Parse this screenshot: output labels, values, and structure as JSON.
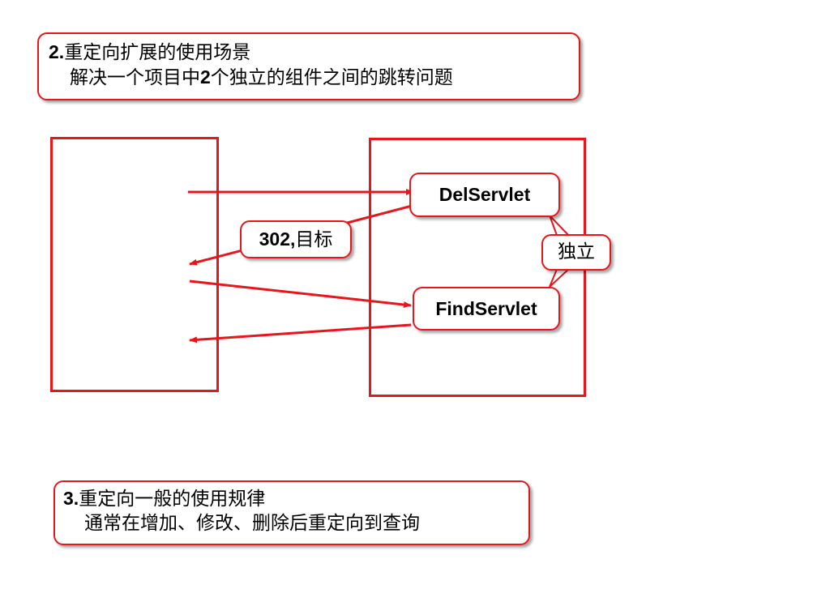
{
  "top_note": {
    "number": "2.",
    "title": "重定向扩展的使用场景",
    "detail_prefix": "解决一个项目中",
    "detail_number": "2",
    "detail_suffix": "个独立的组件之间的跳转问题"
  },
  "bottom_note": {
    "number": "3.",
    "title": "重定向一般的使用规律",
    "detail": "通常在增加、修改、删除后重定向到查询"
  },
  "servlets": {
    "del": "DelServlet",
    "find": "FindServlet"
  },
  "redirect_label": {
    "code": "302,",
    "text": "目标"
  },
  "independent_label": "独立",
  "colors": {
    "accent": "#e8161b"
  }
}
